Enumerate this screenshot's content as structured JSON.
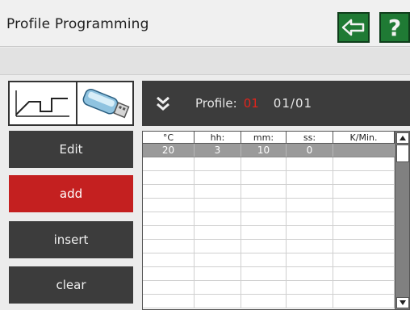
{
  "header": {
    "title": "Profile Programming",
    "back_icon": "back-arrow-icon",
    "help_label": "?",
    "accent_color": "#1f7a34"
  },
  "mode_icons": {
    "profile": "temperature-profile-icon",
    "usb": "usb-stick-icon"
  },
  "profile_bar": {
    "chevron_icon": "double-chevron-down-icon",
    "label": "Profile:",
    "profile_number": "01",
    "page": "01/01",
    "highlight_color": "#e0241c"
  },
  "actions": {
    "edit": "Edit",
    "add": "add",
    "insert": "insert",
    "clear": "clear",
    "active": "add",
    "active_color": "#c42020"
  },
  "table": {
    "columns": [
      "°C",
      "hh:",
      "mm:",
      "ss:",
      "K/Min."
    ],
    "rows": [
      [
        "20",
        "3",
        "10",
        "0",
        ""
      ],
      [
        "",
        "",
        "",
        "",
        ""
      ],
      [
        "",
        "",
        "",
        "",
        ""
      ],
      [
        "",
        "",
        "",
        "",
        ""
      ],
      [
        "",
        "",
        "",
        "",
        ""
      ],
      [
        "",
        "",
        "",
        "",
        ""
      ],
      [
        "",
        "",
        "",
        "",
        ""
      ],
      [
        "",
        "",
        "",
        "",
        ""
      ],
      [
        "",
        "",
        "",
        "",
        ""
      ],
      [
        "",
        "",
        "",
        "",
        ""
      ],
      [
        "",
        "",
        "",
        "",
        ""
      ],
      [
        "",
        "",
        "",
        "",
        ""
      ]
    ],
    "selected_row": 0
  }
}
